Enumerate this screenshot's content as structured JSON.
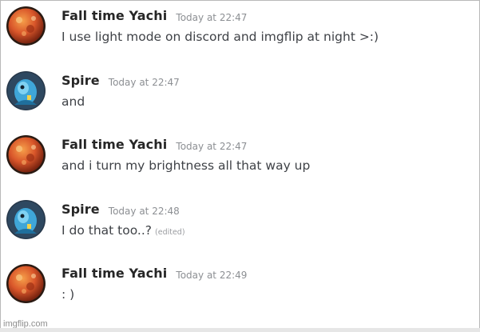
{
  "messages": [
    {
      "author": "Fall time Yachi",
      "time": "Today at 22:47",
      "text": "I use light mode on discord and imgflip at night >:)",
      "edited": "",
      "avatar": "orange-planet-icon"
    },
    {
      "author": "Spire",
      "time": "Today at 22:47",
      "text": "and",
      "edited": "",
      "avatar": "blue-character-icon"
    },
    {
      "author": "Fall time Yachi",
      "time": "Today at 22:47",
      "text": "and i turn my brightness all that way up",
      "edited": "",
      "avatar": "orange-planet-icon"
    },
    {
      "author": "Spire",
      "time": "Today at 22:48",
      "text": "I do that too..?",
      "edited": "(edited)",
      "avatar": "blue-character-icon"
    },
    {
      "author": "Fall time Yachi",
      "time": "Today at 22:49",
      "text": ": )",
      "edited": "",
      "avatar": "orange-planet-icon"
    }
  ],
  "watermark": "imgflip.com",
  "colors": {
    "username": "#262626",
    "timestamp": "#8c8f93",
    "message_text": "#3f4247",
    "background": "#ffffff"
  }
}
